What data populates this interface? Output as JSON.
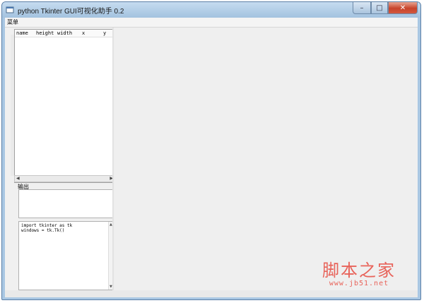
{
  "window": {
    "title": "python Tkinter GUI可视化助手 0.2",
    "buttons": {
      "minimize": "–",
      "maximize": "□",
      "close": "✕"
    }
  },
  "menubar": {
    "items": [
      {
        "label": "菜单"
      }
    ]
  },
  "tree": {
    "columns": [
      "name",
      "height",
      "width",
      "x",
      "y"
    ]
  },
  "output": {
    "label": "输出"
  },
  "code": {
    "lines": "import tkinter as tk\nwindows = tk.Tk()"
  },
  "watermark": {
    "main": "脚本之家",
    "url": "www.jb51.net"
  },
  "colors": {
    "titlebar": "#a9c7e3",
    "close_button": "#c7432b",
    "watermark": "#e8635a",
    "client_bg": "#f0f0f0"
  }
}
